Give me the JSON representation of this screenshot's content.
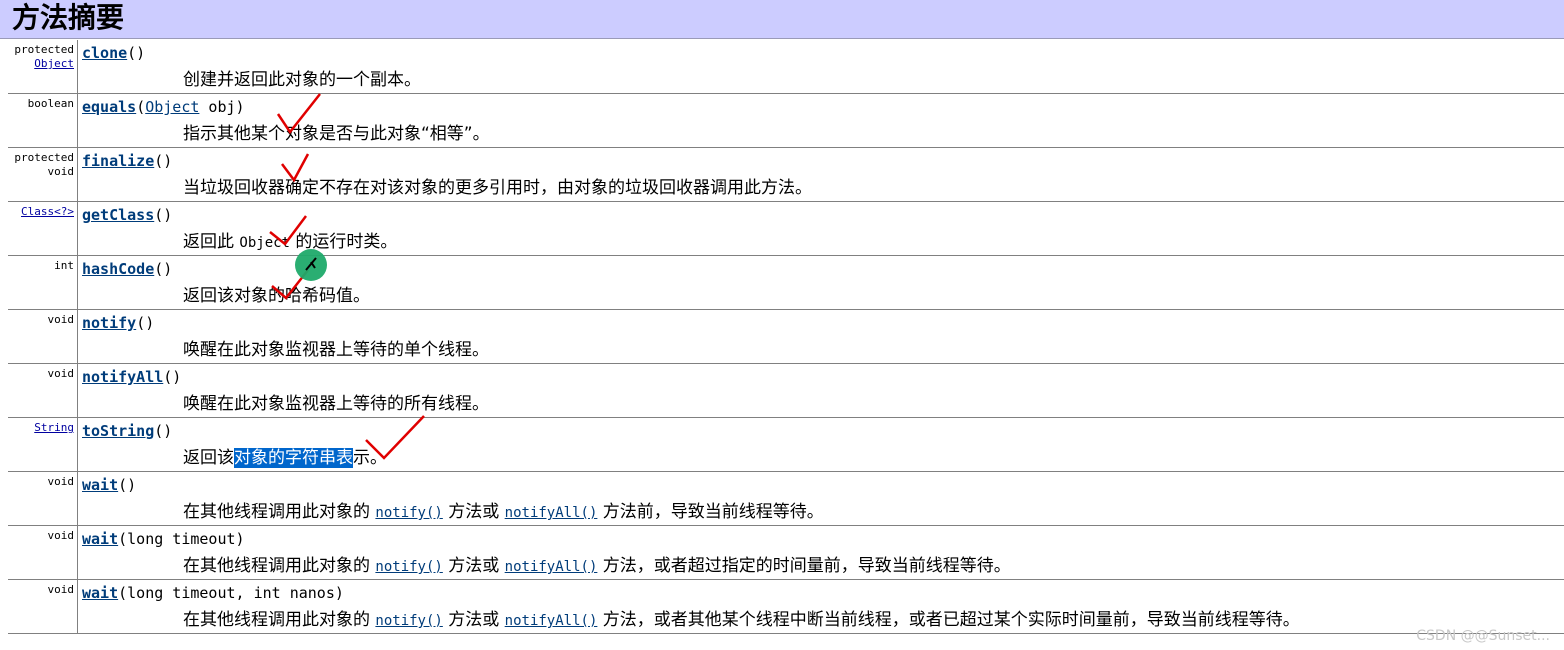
{
  "title": "方法摘要",
  "rows": [
    {
      "modifier1": "protected",
      "modifier2": "Object",
      "method": "clone",
      "params": "()",
      "desc": "创建并返回此对象的一个副本。"
    },
    {
      "modifier1": "boolean",
      "modifier2": "",
      "method": "equals",
      "param_type": "Object",
      "params_rest": " obj)",
      "desc_a": "指示其他某个对象是否与此对象“相等”。"
    },
    {
      "modifier1": "protected",
      "modifier2": "void",
      "method": "finalize",
      "params": "()",
      "desc": "当垃圾回收器确定不存在对该对象的更多引用时，由对象的垃圾回收器调用此方法。"
    },
    {
      "modifier1": "Class<?>",
      "method": "getClass",
      "params": "()",
      "desc_pre": "返回此 ",
      "desc_code": "Object",
      "desc_post": " 的运行时类。"
    },
    {
      "modifier1": "int",
      "method": "hashCode",
      "params": "()",
      "desc": "返回该对象的哈希码值。"
    },
    {
      "modifier1": "void",
      "method": "notify",
      "params": "()",
      "desc": "唤醒在此对象监视器上等待的单个线程。"
    },
    {
      "modifier1": "void",
      "method": "notifyAll",
      "params": "()",
      "desc": "唤醒在此对象监视器上等待的所有线程。"
    },
    {
      "modifier1": "String",
      "method": "toString",
      "params": "()",
      "desc_pre": "返回该",
      "desc_hl": "对象的字符串表",
      "desc_post": "示。"
    },
    {
      "modifier1": "void",
      "method": "wait",
      "params": "()",
      "desc_pre": "在其他线程调用此对象的 ",
      "link1": "notify()",
      "desc_mid": " 方法或 ",
      "link2": "notifyAll()",
      "desc_post": " 方法前，导致当前线程等待。"
    },
    {
      "modifier1": "void",
      "method": "wait",
      "params": "(long timeout)",
      "desc_pre": "在其他线程调用此对象的 ",
      "link1": "notify()",
      "desc_mid": " 方法或 ",
      "link2": "notifyAll()",
      "desc_post": " 方法，或者超过指定的时间量前，导致当前线程等待。"
    },
    {
      "modifier1": "void",
      "method": "wait",
      "params": "(long timeout, int nanos)",
      "desc_pre": "在其他线程调用此对象的 ",
      "link1": "notify()",
      "desc_mid": " 方法或 ",
      "link2": "notifyAll()",
      "desc_post": " 方法，或者其他某个线程中断当前线程，或者已超过某个实际时间量前，导致当前线程等待。"
    }
  ],
  "watermark": "CSDN @@Sunset..."
}
